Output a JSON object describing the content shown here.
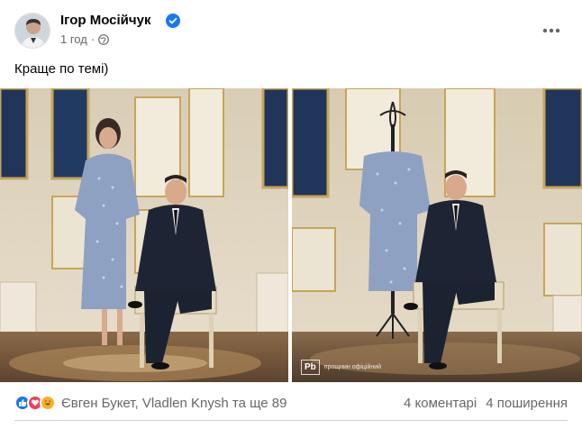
{
  "post": {
    "author": "Ігор Мосійчук",
    "time": "1 год",
    "separator": "·",
    "text": "Краще по темі)",
    "icons": {
      "verified": "verified-badge-icon",
      "audience": "globe-icon",
      "more": "more-options-icon"
    }
  },
  "photos": [
    {
      "name": "photo-left",
      "description_tag": "zelensky-with-woman"
    },
    {
      "name": "photo-right",
      "watermark_logo": "Pb",
      "watermark_text": "прощнин офіційний"
    }
  ],
  "footer": {
    "reaction_icons": [
      "like-icon",
      "love-icon",
      "haha-icon"
    ],
    "reaction_names": "Євген Букет, Vladlen Knysh та ще 89",
    "comments": "4 коментарі",
    "shares": "4 поширення"
  },
  "colors": {
    "text_primary": "#050505",
    "text_secondary": "#65676b",
    "verified_blue": "#1877f2",
    "like_blue": "#1877f2",
    "love_red": "#f33e58",
    "haha_yellow": "#f7b125"
  }
}
